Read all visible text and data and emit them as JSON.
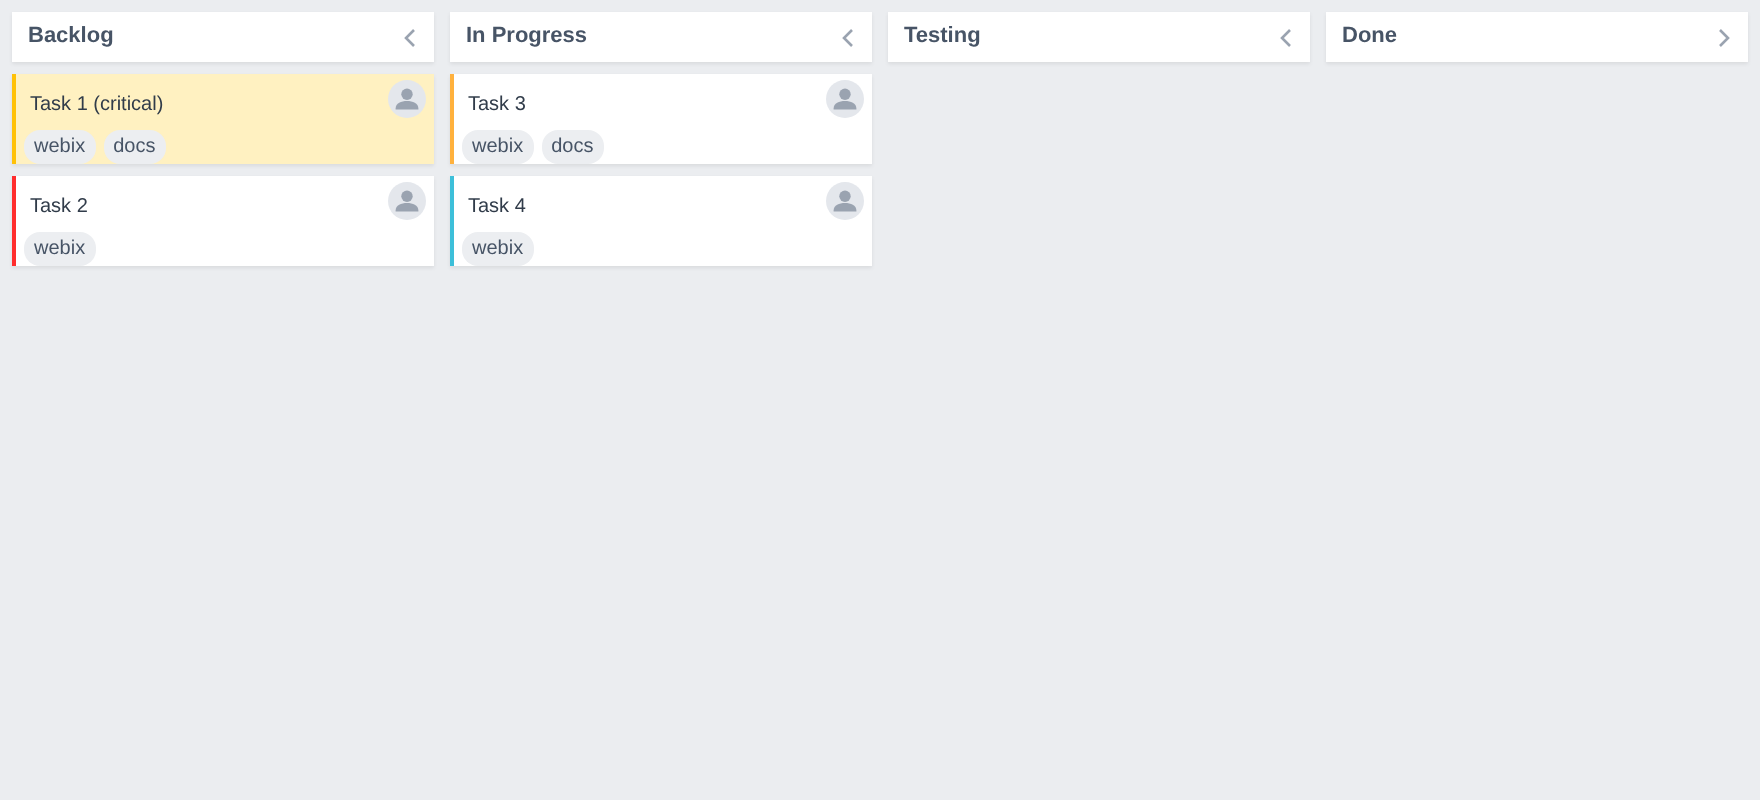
{
  "columns": [
    {
      "title": "Backlog",
      "expanded": true,
      "cards": [
        {
          "title": "Task 1 (critical)",
          "color": "#ffc107",
          "highlighted": true,
          "tags": [
            "webix",
            "docs"
          ]
        },
        {
          "title": "Task 2",
          "color": "#ff2d2d",
          "highlighted": false,
          "tags": [
            "webix"
          ]
        }
      ]
    },
    {
      "title": "In Progress",
      "expanded": true,
      "cards": [
        {
          "title": "Task 3",
          "color": "#ffb13d",
          "highlighted": false,
          "tags": [
            "webix",
            "docs"
          ]
        },
        {
          "title": "Task 4",
          "color": "#3dbfd9",
          "highlighted": false,
          "tags": [
            "webix"
          ]
        }
      ]
    },
    {
      "title": "Testing",
      "expanded": true
    },
    {
      "title": "Done",
      "expanded": false
    }
  ]
}
